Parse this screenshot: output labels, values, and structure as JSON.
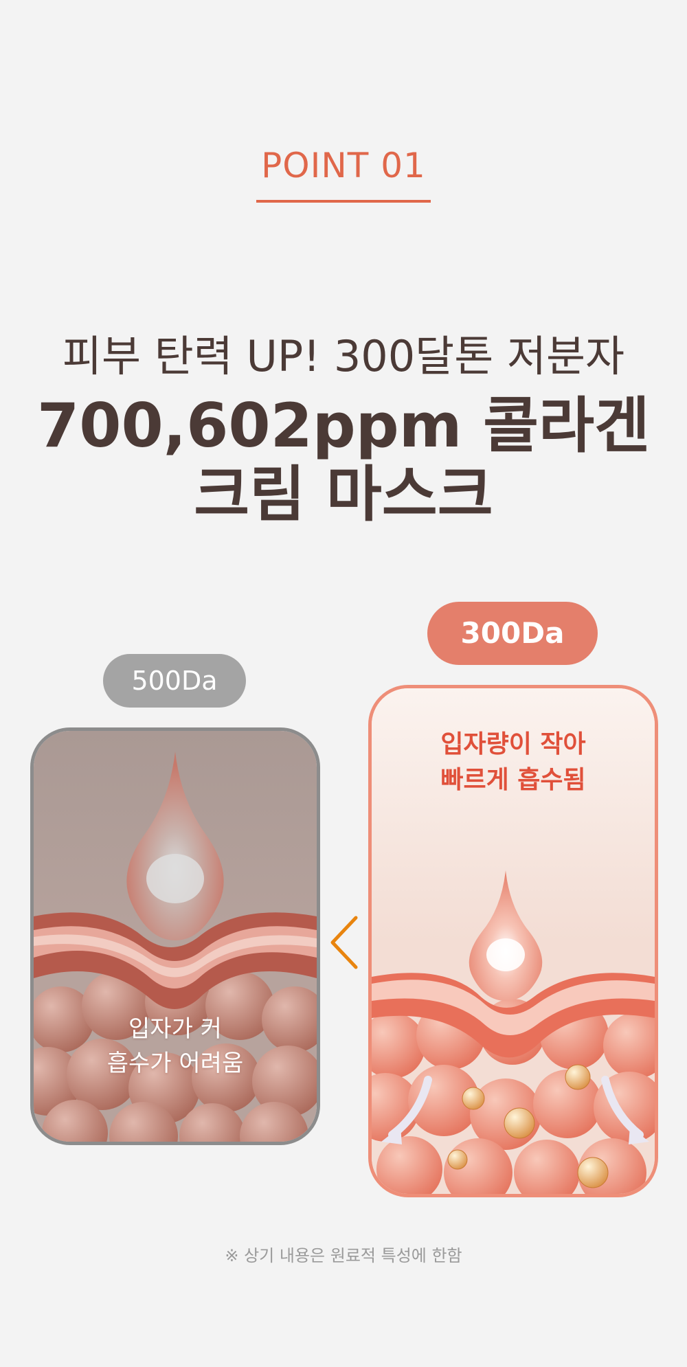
{
  "header": {
    "point_label": "POINT 01"
  },
  "headline": {
    "subtitle": "피부 탄력 UP! 300달톤 저분자",
    "title_line1": "700,602ppm 콜라겐",
    "title_line2": "크림 마스크"
  },
  "comparison": {
    "left": {
      "badge": "500Da",
      "caption_line1": "입자가 커",
      "caption_line2": "흡수가 어려움"
    },
    "right": {
      "badge": "300Da",
      "caption_line1": "입자량이 작아",
      "caption_line2": "빠르게 흡수됨"
    },
    "arrow_icon": "chevron-left-icon"
  },
  "footnote": "※ 상기 내용은 원료적 특성에 한함",
  "colors": {
    "accent": "#e0674a",
    "headline": "#4b3a36",
    "gray_badge": "#a4a4a4",
    "coral_badge": "#e47f6b",
    "arrow": "#e8840e"
  }
}
